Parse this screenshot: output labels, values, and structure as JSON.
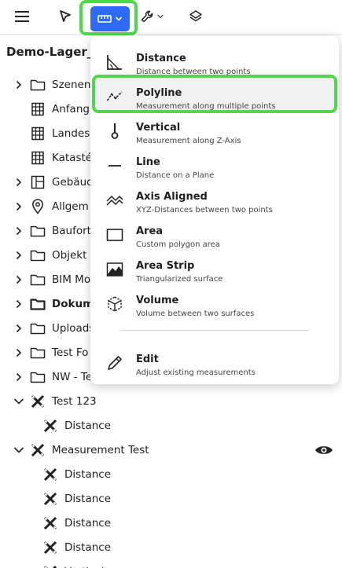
{
  "toolbar": {
    "icons": [
      "menu-icon",
      "pointer-icon",
      "ruler-icon",
      "chevron-down-icon",
      "wrench-icon",
      "chevron-down-icon",
      "layers-icon"
    ],
    "accent": "#2d6af5",
    "highlight": "#4fd94a"
  },
  "project": {
    "title": "Demo-Lager_u"
  },
  "tree": [
    {
      "label": "Szenen",
      "icon": "folder-icon",
      "chevron": true
    },
    {
      "label": "Anfang",
      "icon": "building-icon",
      "chevron": false
    },
    {
      "label": "Landes",
      "icon": "building-icon",
      "chevron": false
    },
    {
      "label": "Katasté",
      "icon": "building-icon",
      "chevron": false
    },
    {
      "label": "Gebäud",
      "icon": "floorplan-icon",
      "chevron": true
    },
    {
      "label": "Allgem",
      "icon": "location-pin-icon",
      "chevron": true
    },
    {
      "label": "Baufort",
      "icon": "folder-icon",
      "chevron": true
    },
    {
      "label": "Objekt ,",
      "icon": "folder-icon",
      "chevron": true
    },
    {
      "label": "BIM Mo",
      "icon": "folder-icon",
      "chevron": true
    },
    {
      "label": "Dokum",
      "icon": "folder-open-icon",
      "chevron": true,
      "bold": true
    },
    {
      "label": "Uploads",
      "icon": "folder-icon",
      "chevron": true
    },
    {
      "label": "Test Fo",
      "icon": "folder-icon",
      "chevron": true
    },
    {
      "label": "NW - Te",
      "icon": "folder-icon",
      "chevron": true
    },
    {
      "label": "Test 123",
      "icon": "measurement-icon",
      "chevron": true,
      "expanded": true
    },
    {
      "label": "Distance",
      "icon": "measurement-icon",
      "child": true
    },
    {
      "label": "Measurement Test",
      "icon": "measurement-icon",
      "chevron": true,
      "expanded": true,
      "eye": true
    },
    {
      "label": "Distance",
      "icon": "measurement-icon",
      "child": true
    },
    {
      "label": "Distance",
      "icon": "measurement-icon",
      "child": true
    },
    {
      "label": "Distance",
      "icon": "measurement-icon",
      "child": true
    },
    {
      "label": "Distance",
      "icon": "measurement-icon",
      "child": true
    },
    {
      "label": "Vertical",
      "icon": "measurement-icon",
      "child": true
    }
  ],
  "menu": {
    "items": [
      {
        "title": "Distance",
        "subtitle": "Distance between two points",
        "icon": "angle-ruler-icon"
      },
      {
        "title": "Polyline",
        "subtitle": "Measurement along multiple points",
        "icon": "polyline-icon",
        "selected": true
      },
      {
        "title": "Vertical",
        "subtitle": "Measurement along Z-Axis",
        "icon": "vertical-icon"
      },
      {
        "title": "Line",
        "subtitle": "Distance on a Plane",
        "icon": "line-icon"
      },
      {
        "title": "Axis Aligned",
        "subtitle": "XYZ-Distances between two points",
        "icon": "axis-aligned-icon"
      },
      {
        "title": "Area",
        "subtitle": "Custom polygon area",
        "icon": "area-icon"
      },
      {
        "title": "Area Strip",
        "subtitle": "Triangularized surface",
        "icon": "area-strip-icon"
      },
      {
        "title": "Volume",
        "subtitle": "Volume between two surfaces",
        "icon": "volume-icon"
      },
      {
        "title": "Edit",
        "subtitle": "Adjust existing measurements",
        "icon": "pencil-icon"
      }
    ]
  }
}
